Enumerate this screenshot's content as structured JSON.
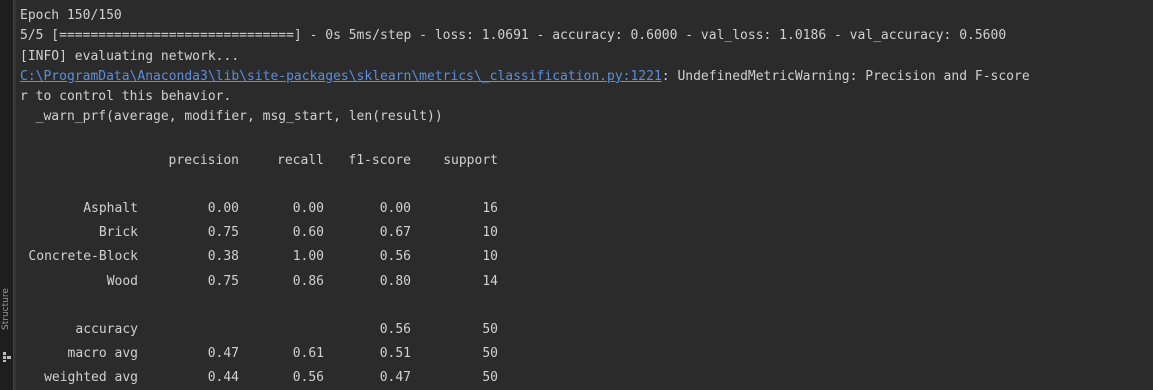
{
  "sidebar": {
    "structure_label": "Structure",
    "structure_icon": "structure-icon"
  },
  "console": {
    "epoch_line": "Epoch 150/150",
    "progress_line": "5/5 [==============================] - 0s 5ms/step - loss: 1.0691 - accuracy: 0.6000 - val_loss: 1.0186 - val_accuracy: 0.5600",
    "info_line": "[INFO] evaluating network...",
    "warning_link": "C:\\ProgramData\\Anaconda3\\lib\\site-packages\\sklearn\\metrics\\_classification.py:1221",
    "warning_text": ": UndefinedMetricWarning: Precision and F-score",
    "control_line": "r to control this behavior.",
    "warn_call_line": "  _warn_prf(average, modifier, msg_start, len(result))"
  },
  "report": {
    "headers": [
      "",
      "precision",
      "recall",
      "f1-score",
      "support"
    ],
    "classes": [
      {
        "label": "Asphalt",
        "precision": "0.00",
        "recall": "0.00",
        "f1": "0.00",
        "support": "16"
      },
      {
        "label": "Brick",
        "precision": "0.75",
        "recall": "0.60",
        "f1": "0.67",
        "support": "10"
      },
      {
        "label": "Concrete-Block",
        "precision": "0.38",
        "recall": "1.00",
        "f1": "0.56",
        "support": "10"
      },
      {
        "label": "Wood",
        "precision": "0.75",
        "recall": "0.86",
        "f1": "0.80",
        "support": "14"
      }
    ],
    "accuracy": {
      "label": "accuracy",
      "f1": "0.56",
      "support": "50"
    },
    "macro_avg": {
      "label": "macro avg",
      "precision": "0.47",
      "recall": "0.61",
      "f1": "0.51",
      "support": "50"
    },
    "weighted_avg": {
      "label": "weighted avg",
      "precision": "0.44",
      "recall": "0.56",
      "f1": "0.47",
      "support": "50"
    }
  },
  "colors": {
    "background": "#2b2b2b",
    "text": "#d0d0d0",
    "link": "#5a8ede"
  }
}
